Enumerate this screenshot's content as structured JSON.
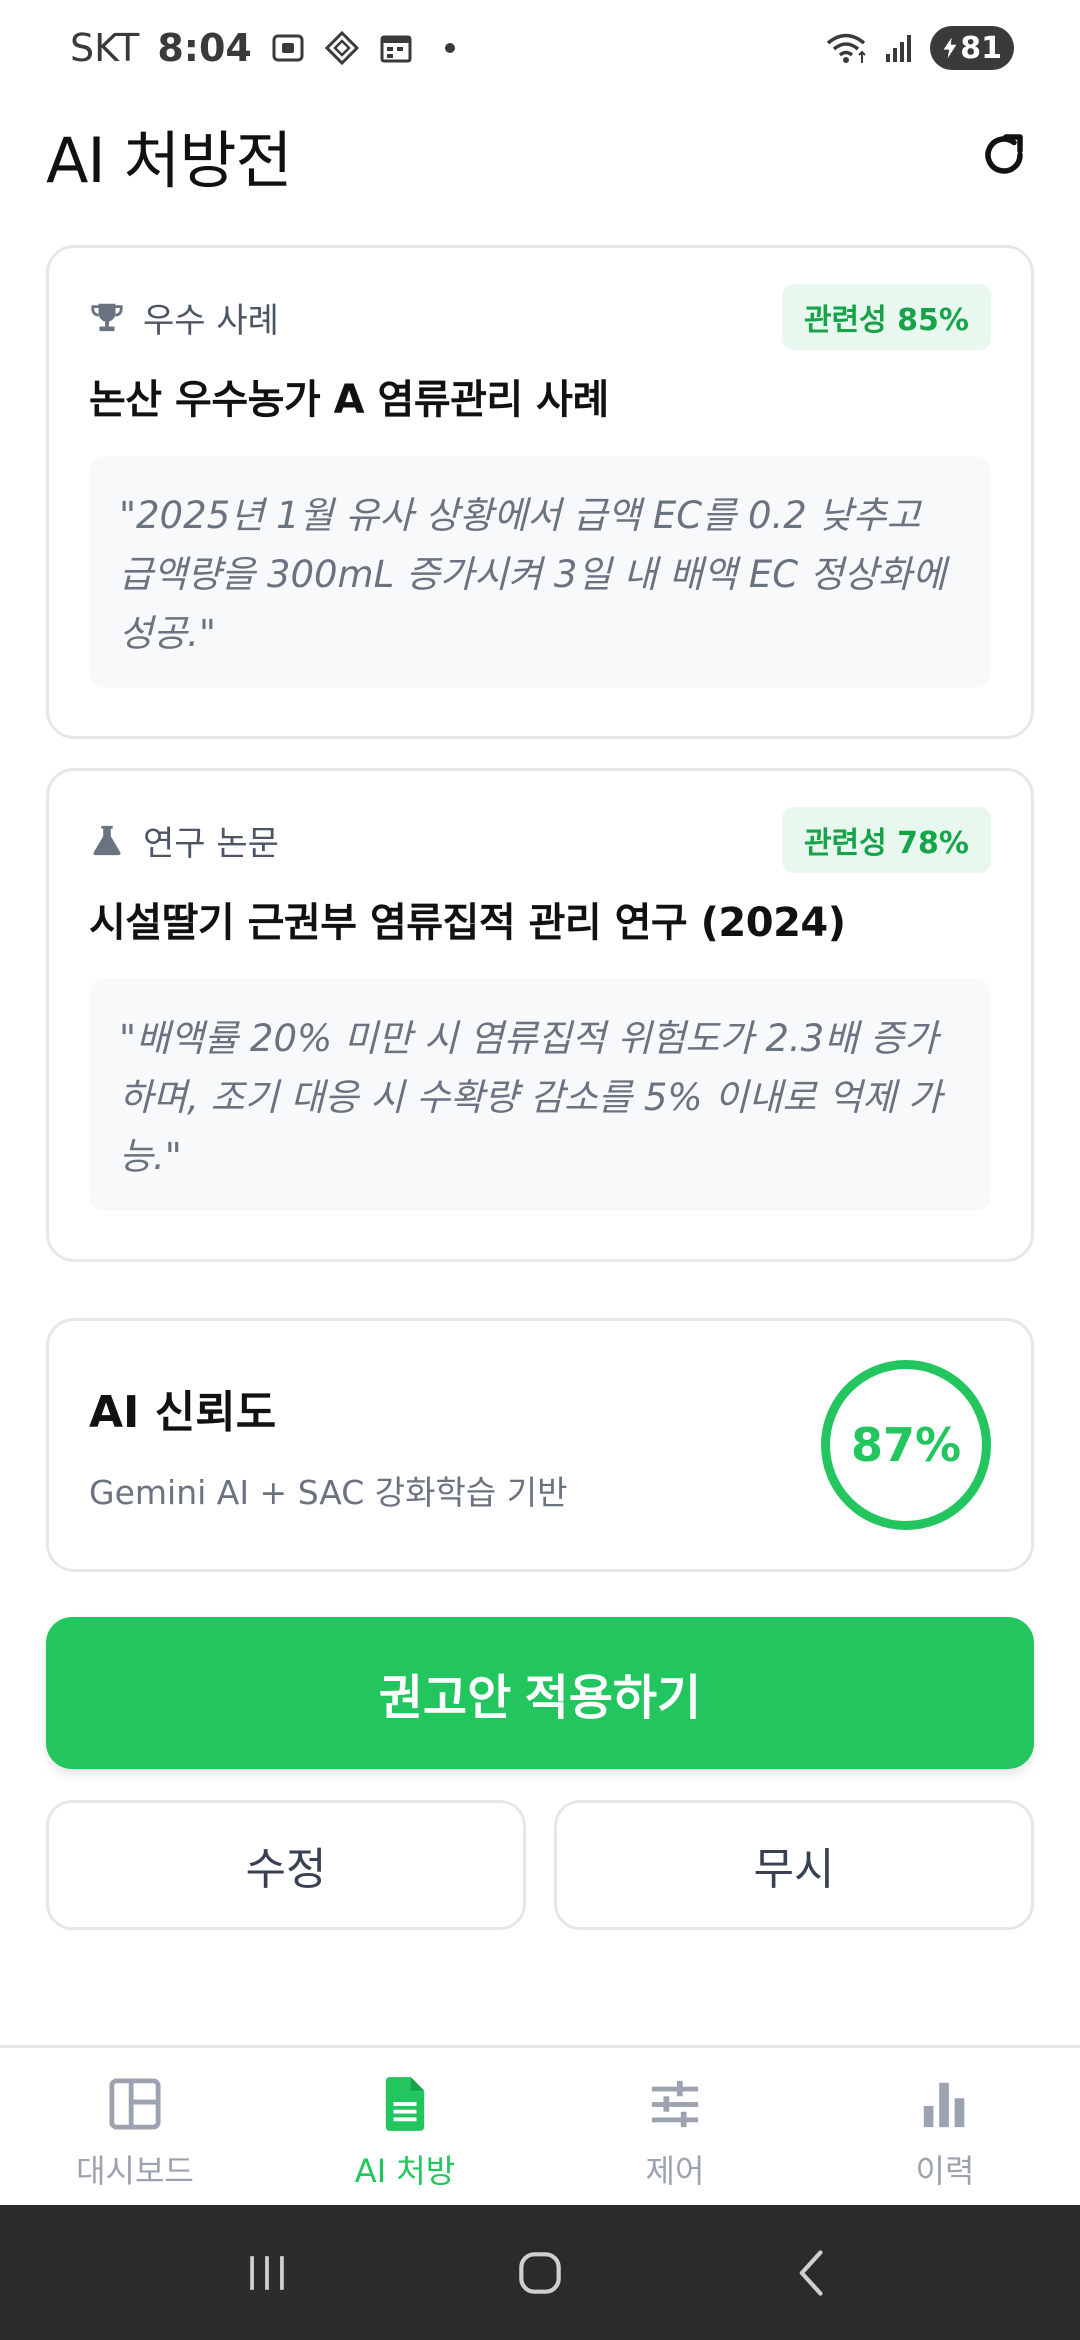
{
  "status_bar": {
    "carrier": "SKT",
    "time": "8:04",
    "battery": "81"
  },
  "header": {
    "title": "AI 처방전"
  },
  "references": [
    {
      "kind": "우수 사례",
      "icon": "trophy-icon",
      "relevance": "관련성 85%",
      "title": "논산 우수농가 A 염류관리 사례",
      "quote": "\"2025년 1월 유사 상황에서 급액 EC를 0.2 낮추고 급액량을 300mL 증가시켜 3일 내 배액 EC 정상화에 성공.\""
    },
    {
      "kind": "연구 논문",
      "icon": "flask-icon",
      "relevance": "관련성 78%",
      "title": "시설딸기 근권부 염류집적 관리 연구 (2024)",
      "quote": "\"배액률 20% 미만 시 염류집적 위험도가 2.3배 증가하며, 조기 대응 시 수확량 감소를 5% 이내로 억제 가능.\""
    }
  ],
  "confidence": {
    "title": "AI 신뢰도",
    "subtitle": "Gemini AI + SAC 강화학습 기반",
    "value": "87%"
  },
  "actions": {
    "apply": "권고안 적용하기",
    "edit": "수정",
    "ignore": "무시"
  },
  "nav": {
    "items": [
      {
        "label": "대시보드",
        "icon": "dashboard-icon",
        "active": false
      },
      {
        "label": "AI 처방",
        "icon": "document-icon",
        "active": true
      },
      {
        "label": "제어",
        "icon": "sliders-icon",
        "active": false
      },
      {
        "label": "이력",
        "icon": "bar-chart-icon",
        "active": false
      }
    ]
  },
  "colors": {
    "accent": "#22c55e",
    "badge_bg": "#e8f8ee",
    "border": "#e5e7eb"
  }
}
